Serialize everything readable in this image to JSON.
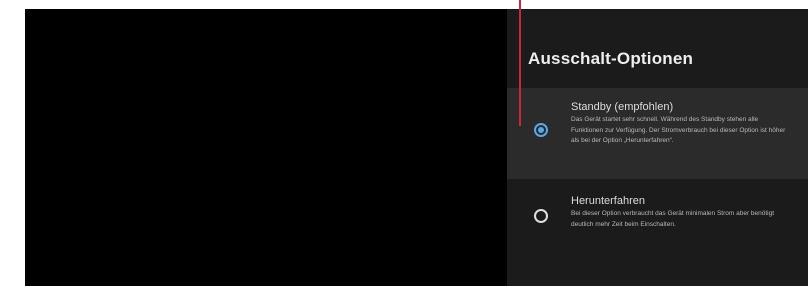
{
  "panel": {
    "title": "Ausschalt-Optionen"
  },
  "options": [
    {
      "title": "Standby (empfohlen)",
      "description": "Das Gerät startet sehr schnell. Während des Standby stehen alle Funktionen zur Verfügung. Der Stromverbrauch bei dieser Option ist höher als bei der Option „Herunterfahren“.",
      "selected": true
    },
    {
      "title": "Herunterfahren",
      "description": "Bei dieser Option verbraucht das Gerät minimalen Strom aber benötigt deutlich mehr Zeit beim Einschalten.",
      "selected": false
    }
  ],
  "colors": {
    "accent": "#5aa8e8",
    "marker": "#c8283c",
    "panel_bg": "#1b1b1b",
    "selected_bg": "#2b2b2b"
  }
}
